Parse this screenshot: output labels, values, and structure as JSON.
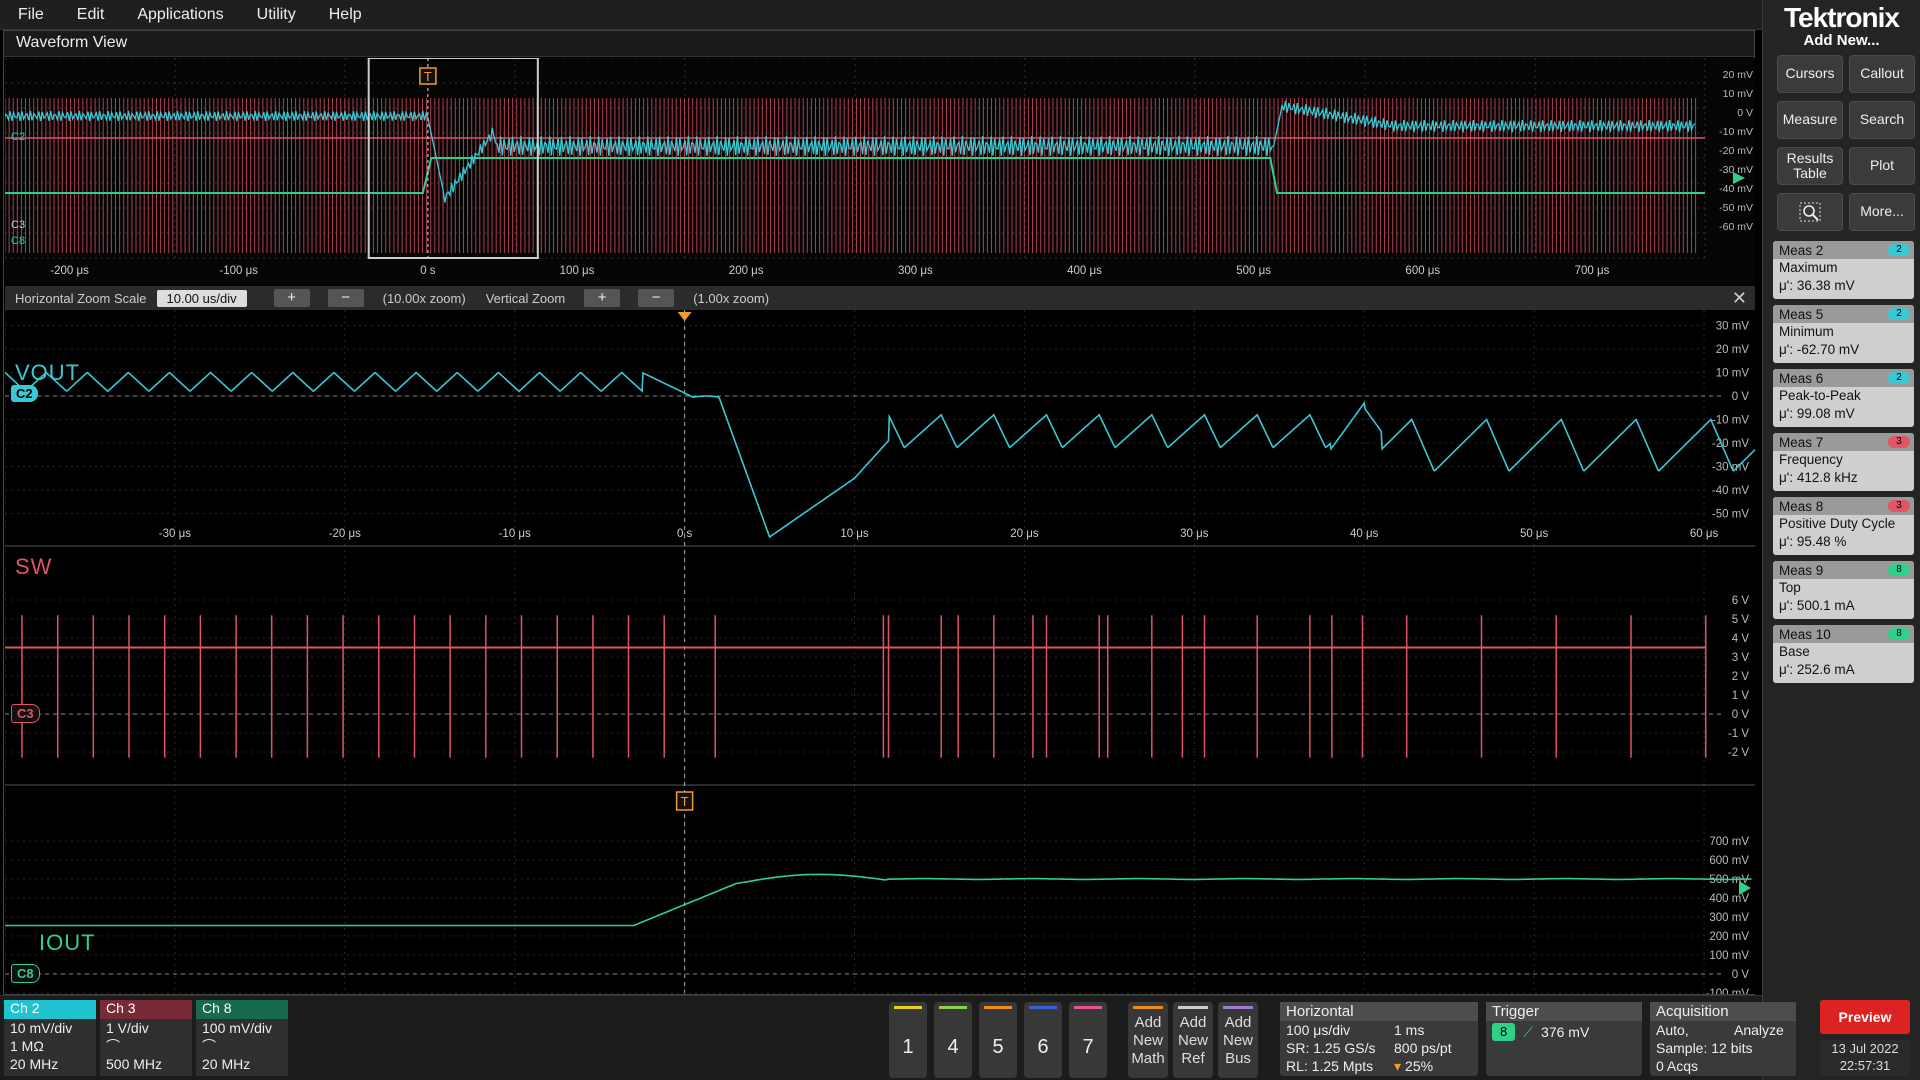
{
  "menu": {
    "file": "File",
    "edit": "Edit",
    "applications": "Applications",
    "utility": "Utility",
    "help": "Help"
  },
  "window_title": "Waveform View",
  "brand": "Tektronix",
  "add_new": "Add New...",
  "right_buttons": {
    "cursors": "Cursors",
    "callout": "Callout",
    "measure": "Measure",
    "search": "Search",
    "results_table_1": "Results",
    "results_table_2": "Table",
    "plot": "Plot",
    "more": "More..."
  },
  "measurements": [
    {
      "title": "Meas 2",
      "type": "Maximum",
      "value": "μ': 36.38 mV",
      "channel": "2",
      "color": "#3ac9d4"
    },
    {
      "title": "Meas 5",
      "type": "Minimum",
      "value": "μ': -62.70 mV",
      "channel": "2",
      "color": "#3ac9d4"
    },
    {
      "title": "Meas 6",
      "type": "Peak-to-Peak",
      "value": "μ': 99.08 mV",
      "channel": "2",
      "color": "#3ac9d4"
    },
    {
      "title": "Meas 7",
      "type": "Frequency",
      "value": "μ': 412.8 kHz",
      "channel": "3",
      "color": "#e05565"
    },
    {
      "title": "Meas 8",
      "type": "Positive Duty Cycle",
      "value": "μ': 95.48 %",
      "channel": "3",
      "color": "#e05565"
    },
    {
      "title": "Meas 9",
      "type": "Top",
      "value": "μ': 500.1 mA",
      "channel": "8",
      "color": "#2fd18a"
    },
    {
      "title": "Meas 10",
      "type": "Base",
      "value": "μ': 252.6 mA",
      "channel": "8",
      "color": "#2fd18a"
    }
  ],
  "zoom": {
    "h_label": "Horizontal Zoom Scale",
    "h_value": "10.00 us/div",
    "h_zoom": "(10.00x zoom)",
    "v_label": "Vertical Zoom",
    "v_zoom": "(1.00x zoom)"
  },
  "overview_xticks": [
    "-200 μs",
    "-100 μs",
    "0 s",
    "100 μs",
    "200 μs",
    "300 μs",
    "400 μs",
    "500 μs",
    "600 μs",
    "700 μs"
  ],
  "overview_yticks": [
    "20 mV",
    "10 mV",
    "0 V",
    "-10 mV",
    "-20 mV",
    "-30 mV",
    "-40 mV",
    "-50 mV",
    "-60 mV"
  ],
  "overview_labels": {
    "c2": "C2",
    "c3": "C3",
    "c8": "C8"
  },
  "zoom_xticks": [
    "-30 μs",
    "-20 μs",
    "-10 μs",
    "0 s",
    "10 μs",
    "20 μs",
    "30 μs",
    "40 μs",
    "50 μs",
    "60 μs"
  ],
  "vout": {
    "label": "VOUT",
    "badge": "C2",
    "yticks": [
      "30 mV",
      "20 mV",
      "10 mV",
      "0 V",
      "-10 mV",
      "-20 mV",
      "-30 mV",
      "-40 mV",
      "-50 mV"
    ]
  },
  "sw": {
    "label": "SW",
    "badge": "C3",
    "yticks": [
      "6 V",
      "5 V",
      "4 V",
      "3 V",
      "2 V",
      "1 V",
      "0 V",
      "-1 V",
      "-2 V"
    ]
  },
  "iout": {
    "label": "IOUT",
    "badge": "C8",
    "yticks": [
      "700 mV",
      "600 mV",
      "500 mV",
      "400 mV",
      "300 mV",
      "200 mV",
      "100 mV",
      "0 V",
      "-100 mV"
    ]
  },
  "trigger_marker": "T",
  "channels": [
    {
      "name": "Ch 2",
      "scale": "10 mV/div",
      "imp": "1 MΩ",
      "bw": "20 MHz",
      "color": "#1fc4d0"
    },
    {
      "name": "Ch 3",
      "scale": "1 V/div",
      "imp": "",
      "bw": "500 MHz",
      "color": "#7a2a36"
    },
    {
      "name": "Ch 8",
      "scale": "100 mV/div",
      "imp": "",
      "bw": "20 MHz",
      "color": "#156b4c"
    }
  ],
  "num_buttons": [
    {
      "label": "1",
      "color": "#e6d21e"
    },
    {
      "label": "4",
      "color": "#8bd14a"
    },
    {
      "label": "5",
      "color": "#f08a1e"
    },
    {
      "label": "6",
      "color": "#3a5fd8"
    },
    {
      "label": "7",
      "color": "#e05596"
    }
  ],
  "add_buttons": [
    {
      "l1": "Add",
      "l2": "New",
      "l3": "Math",
      "color": "#f08a1e"
    },
    {
      "l1": "Add",
      "l2": "New",
      "l3": "Ref",
      "color": "#cccccc"
    },
    {
      "l1": "Add",
      "l2": "New",
      "l3": "Bus",
      "color": "#a07ad8"
    }
  ],
  "horizontal": {
    "title": "Horizontal",
    "a1": "100 μs/div",
    "a2": "1 ms",
    "b1": "SR: 1.25 GS/s",
    "b2": "800 ps/pt",
    "c1": "RL: 1.25 Mpts",
    "c2": "25%"
  },
  "trigger": {
    "title": "Trigger",
    "channel": "8",
    "level": "376 mV"
  },
  "acquisition": {
    "title": "Acquisition",
    "mode": "Auto,",
    "analyze": "Analyze",
    "sample": "Sample: 12 bits",
    "acqs": "0 Acqs"
  },
  "preview": "Preview",
  "date": "13 Jul 2022",
  "time": "22:57:31",
  "colors": {
    "ch2": "#3ac9d4",
    "ch3": "#e05565",
    "ch8": "#2fd18a",
    "trigger": "#f39a2b"
  }
}
